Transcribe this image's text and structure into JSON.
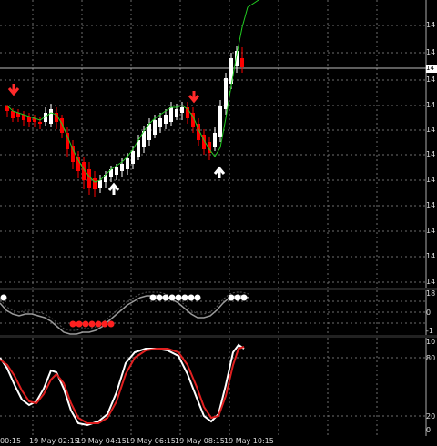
{
  "colors": {
    "background": "#000000",
    "grid": "#6e6e6e",
    "bull_candle": "#ffffff",
    "bear_candle": "#ff0000",
    "ma_line": "#22cc22",
    "signal_down": "#ff2a2a",
    "signal_up": "#ffffff",
    "osc_line": "#9a9a9a",
    "stoch_main": "#ffffff",
    "stoch_signal": "#e02020"
  },
  "price_axis_labels": [
    "14",
    "14",
    "14",
    "14",
    "14",
    "14",
    "14",
    "14",
    "14",
    "14",
    "14"
  ],
  "price_tag": "14",
  "osc_axis_labels": [
    "18",
    "0.",
    "-1"
  ],
  "stoch_axis_labels": [
    "10",
    "80",
    "20",
    "0"
  ],
  "time_labels": [
    "00:15",
    "19 May 02:15",
    "19 May 04:15",
    "19 May 06:15",
    "19 May 08:15",
    "19 May 10:15"
  ],
  "chart_data": [
    {
      "type": "candlestick",
      "candles": [
        {
          "o": 116,
          "h": 115,
          "l": 128,
          "c": 122,
          "dir": "bear"
        },
        {
          "o": 122,
          "h": 119,
          "l": 134,
          "c": 130,
          "dir": "bear"
        },
        {
          "o": 124,
          "h": 120,
          "l": 134,
          "c": 128,
          "dir": "bear"
        },
        {
          "o": 126,
          "h": 122,
          "l": 138,
          "c": 132,
          "dir": "bear"
        },
        {
          "o": 128,
          "h": 124,
          "l": 140,
          "c": 134,
          "dir": "bear"
        },
        {
          "o": 130,
          "h": 126,
          "l": 140,
          "c": 134,
          "dir": "bear"
        },
        {
          "o": 134,
          "h": 128,
          "l": 142,
          "c": 136,
          "dir": "bear"
        },
        {
          "o": 134,
          "h": 118,
          "l": 138,
          "c": 124,
          "dir": "bull"
        },
        {
          "o": 136,
          "h": 114,
          "l": 140,
          "c": 120,
          "dir": "bull"
        },
        {
          "o": 124,
          "h": 118,
          "l": 142,
          "c": 134,
          "dir": "bear"
        },
        {
          "o": 130,
          "h": 126,
          "l": 152,
          "c": 146,
          "dir": "bear"
        },
        {
          "o": 146,
          "h": 140,
          "l": 172,
          "c": 164,
          "dir": "bear"
        },
        {
          "o": 160,
          "h": 154,
          "l": 186,
          "c": 178,
          "dir": "bear"
        },
        {
          "o": 172,
          "h": 166,
          "l": 196,
          "c": 188,
          "dir": "bear"
        },
        {
          "o": 178,
          "h": 172,
          "l": 208,
          "c": 198,
          "dir": "bear"
        },
        {
          "o": 186,
          "h": 178,
          "l": 214,
          "c": 206,
          "dir": "bear"
        },
        {
          "o": 196,
          "h": 188,
          "l": 216,
          "c": 208,
          "dir": "bear"
        },
        {
          "o": 206,
          "h": 192,
          "l": 212,
          "c": 198,
          "dir": "bull"
        },
        {
          "o": 200,
          "h": 188,
          "l": 206,
          "c": 192,
          "dir": "bull"
        },
        {
          "o": 194,
          "h": 182,
          "l": 200,
          "c": 186,
          "dir": "bull"
        },
        {
          "o": 192,
          "h": 180,
          "l": 198,
          "c": 184,
          "dir": "bull"
        },
        {
          "o": 188,
          "h": 174,
          "l": 194,
          "c": 180,
          "dir": "bull"
        },
        {
          "o": 186,
          "h": 168,
          "l": 192,
          "c": 174,
          "dir": "bull"
        },
        {
          "o": 180,
          "h": 160,
          "l": 186,
          "c": 166,
          "dir": "bull"
        },
        {
          "o": 172,
          "h": 148,
          "l": 176,
          "c": 154,
          "dir": "bull"
        },
        {
          "o": 162,
          "h": 138,
          "l": 168,
          "c": 144,
          "dir": "bull"
        },
        {
          "o": 154,
          "h": 130,
          "l": 160,
          "c": 136,
          "dir": "bull"
        },
        {
          "o": 148,
          "h": 126,
          "l": 152,
          "c": 132,
          "dir": "bull"
        },
        {
          "o": 140,
          "h": 124,
          "l": 146,
          "c": 130,
          "dir": "bull"
        },
        {
          "o": 136,
          "h": 120,
          "l": 142,
          "c": 126,
          "dir": "bull"
        },
        {
          "o": 134,
          "h": 112,
          "l": 138,
          "c": 118,
          "dir": "bull"
        },
        {
          "o": 128,
          "h": 114,
          "l": 132,
          "c": 120,
          "dir": "bull"
        },
        {
          "o": 124,
          "h": 112,
          "l": 132,
          "c": 118,
          "dir": "bull"
        },
        {
          "o": 118,
          "h": 112,
          "l": 136,
          "c": 130,
          "dir": "bear"
        },
        {
          "o": 124,
          "h": 118,
          "l": 146,
          "c": 140,
          "dir": "bear"
        },
        {
          "o": 136,
          "h": 130,
          "l": 160,
          "c": 154,
          "dir": "bear"
        },
        {
          "o": 148,
          "h": 142,
          "l": 170,
          "c": 164,
          "dir": "bear"
        },
        {
          "o": 156,
          "h": 150,
          "l": 176,
          "c": 168,
          "dir": "bear"
        },
        {
          "o": 162,
          "h": 140,
          "l": 166,
          "c": 146,
          "dir": "bull"
        },
        {
          "o": 150,
          "h": 110,
          "l": 156,
          "c": 116,
          "dir": "bull"
        },
        {
          "o": 120,
          "h": 80,
          "l": 126,
          "c": 86,
          "dir": "bull"
        },
        {
          "o": 92,
          "h": 58,
          "l": 98,
          "c": 64,
          "dir": "bull"
        },
        {
          "o": 72,
          "h": 50,
          "l": 80,
          "c": 56,
          "dir": "bull"
        },
        {
          "o": 64,
          "h": 52,
          "l": 80,
          "c": 74,
          "dir": "bear"
        }
      ],
      "ma_line": [
        116,
        122,
        124,
        126,
        128,
        130,
        132,
        128,
        124,
        126,
        136,
        150,
        164,
        176,
        186,
        194,
        200,
        198,
        192,
        186,
        182,
        178,
        172,
        164,
        154,
        144,
        136,
        130,
        126,
        122,
        118,
        118,
        116,
        120,
        128,
        142,
        154,
        164,
        172,
        162,
        130,
        94,
        60,
        30,
        8,
        4,
        0
      ],
      "signals_down": [
        {
          "candle": 1
        },
        {
          "candle": 36
        }
      ],
      "signals_up": [
        {
          "candle": 20
        },
        {
          "candle": 40
        }
      ]
    },
    {
      "type": "line",
      "name": "oscillator",
      "values": [
        330,
        335,
        338,
        340,
        338,
        342,
        348,
        356,
        364,
        368,
        370,
        368,
        366,
        364,
        362,
        358,
        352,
        346,
        340,
        334,
        330,
        326,
        326,
        328,
        330,
        332,
        334,
        336,
        340,
        346,
        350,
        352,
        350,
        346,
        340,
        334,
        330,
        326,
        322,
        322
      ]
    },
    {
      "type": "line",
      "name": "stochastic",
      "main": [
        392,
        404,
        424,
        440,
        444,
        436,
        416,
        408,
        428,
        452,
        466,
        464,
        460,
        454,
        434,
        412,
        396,
        388,
        386,
        384,
        386,
        390,
        410,
        440,
        458,
        462,
        448,
        416,
        386,
        382
      ],
      "signal": [
        392,
        400,
        414,
        432,
        442,
        440,
        422,
        412,
        418,
        440,
        458,
        462,
        456,
        450,
        438,
        420,
        404,
        394,
        390,
        388,
        386,
        388,
        398,
        424,
        448,
        458,
        452,
        428,
        400,
        384
      ]
    }
  ]
}
